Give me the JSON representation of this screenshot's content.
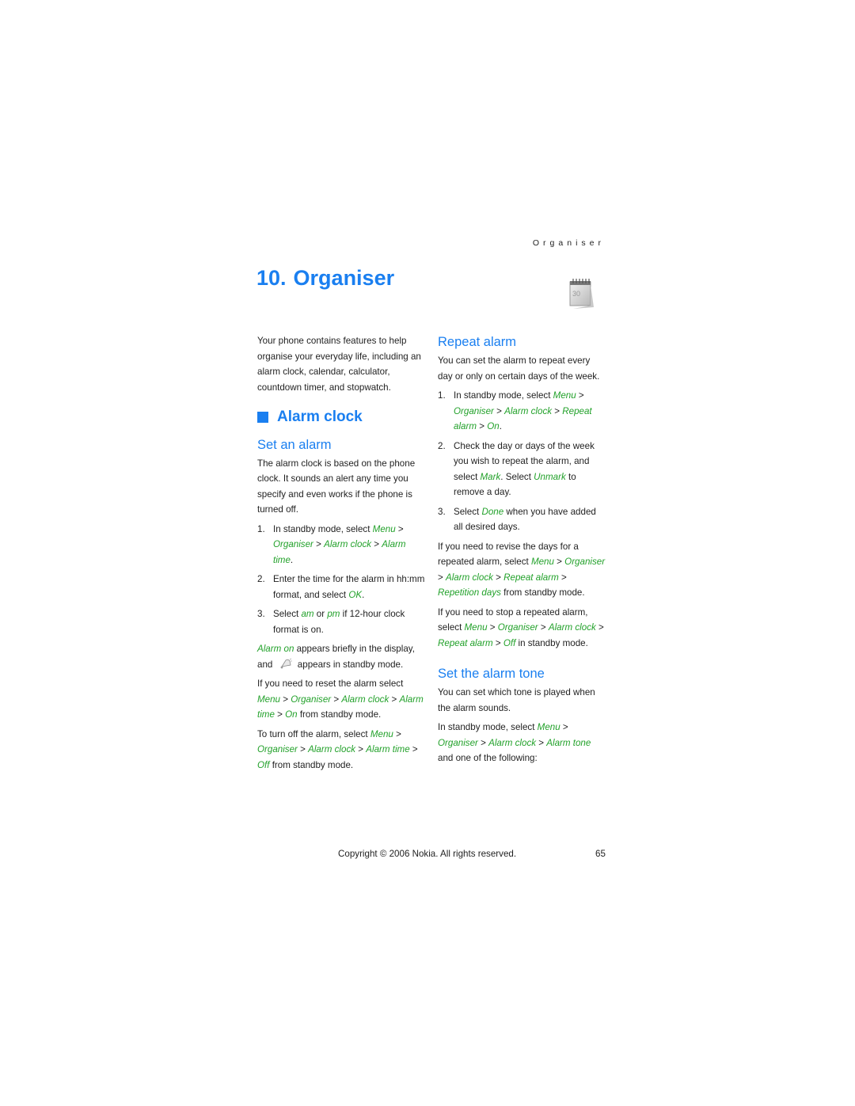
{
  "header": {
    "running_title": "Organiser"
  },
  "chapter": {
    "number": "10.",
    "title": "Organiser",
    "icon": "calendar-icon"
  },
  "intro": "Your phone contains features to help organise your everyday life, including an alarm clock, calendar, calculator, countdown timer, and stopwatch.",
  "alarm_clock": {
    "heading": "Alarm clock",
    "set_alarm": {
      "heading": "Set an alarm",
      "para": "The alarm clock is based on the phone clock. It sounds an alert any time you specify and even works if the phone is turned off.",
      "steps": [
        {
          "n": "1.",
          "t1": "In standby mode, select ",
          "m1": "Menu",
          "s1": " > ",
          "m2": "Organiser",
          "s2": " > ",
          "m3": "Alarm clock",
          "s3": " > ",
          "m4": "Alarm time",
          "t2": "."
        },
        {
          "n": "2.",
          "t1": "Enter the time for the alarm in hh:mm format, and select ",
          "m1": "OK",
          "t2": "."
        },
        {
          "n": "3.",
          "t1": "Select ",
          "m1": "am",
          "t2": " or ",
          "m2": "pm",
          "t3": " if 12-hour clock format is on."
        }
      ],
      "alarm_on": {
        "m1": "Alarm on",
        "t1": " appears briefly in the display, and ",
        "icon": "alarm-bell-icon",
        "t2": " appears in standby mode."
      },
      "reset": {
        "t1": "If you need to reset the alarm select ",
        "m1": "Menu",
        "s1": " > ",
        "m2": "Organiser",
        "s2": " > ",
        "m3": "Alarm clock",
        "s3": " > ",
        "m4": "Alarm time",
        "s4": " > ",
        "m5": "On",
        "t2": " from standby mode."
      },
      "turn_off": {
        "t1": "To turn off the alarm, select ",
        "m1": "Menu",
        "s1": " > ",
        "m2": "Organiser",
        "s2": " > ",
        "m3": "Alarm clock",
        "s3": " > ",
        "m4": "Alarm time",
        "s4": " > ",
        "m5": "Off",
        "t2": " from standby mode."
      }
    },
    "repeat_alarm": {
      "heading": "Repeat alarm",
      "para": "You can set the alarm to repeat every day or only on certain days of the week.",
      "steps": [
        {
          "n": "1.",
          "t1": "In standby mode, select ",
          "m1": "Menu",
          "s1": " > ",
          "m2": "Organiser",
          "s2": " > ",
          "m3": "Alarm clock",
          "s3": " > ",
          "m4": "Repeat alarm",
          "s4": " > ",
          "m5": "On",
          "t2": "."
        },
        {
          "n": "2.",
          "t1": "Check the day or days of the week you wish to repeat the alarm, and select ",
          "m1": "Mark",
          "t2": ". Select ",
          "m2": "Unmark",
          "t3": " to remove a day."
        },
        {
          "n": "3.",
          "t1": "Select ",
          "m1": "Done",
          "t2": " when you have added all desired days."
        }
      ],
      "revise": {
        "t1": "If you need to revise the days for a repeated alarm, select ",
        "m1": "Menu",
        "s1": " > ",
        "m2": "Organiser",
        "s2": " > ",
        "m3": "Alarm clock",
        "s3": " > ",
        "m4": "Repeat alarm",
        "s4": " > ",
        "m5": "Repetition days",
        "t2": " from standby mode."
      },
      "stop": {
        "t1": "If you need to stop a repeated alarm, select ",
        "m1": "Menu",
        "s1": " > ",
        "m2": "Organiser",
        "s2": " > ",
        "m3": "Alarm clock",
        "s3": " > ",
        "m4": "Repeat alarm",
        "s4": " > ",
        "m5": "Off",
        "t2": " in standby mode."
      }
    },
    "alarm_tone": {
      "heading": "Set the alarm tone",
      "para": "You can set which tone is played when the alarm sounds.",
      "instr": {
        "t1": "In standby mode, select ",
        "m1": "Menu",
        "s1": " > ",
        "m2": "Organiser",
        "s2": " > ",
        "m3": "Alarm clock",
        "s3": " > ",
        "m4": "Alarm tone",
        "t2": " and one of the following:"
      }
    }
  },
  "footer": {
    "copyright": "Copyright © 2006 Nokia. All rights reserved.",
    "page_number": "65"
  },
  "colors": {
    "heading_blue": "#1a7ff0",
    "menu_green": "#22a12a",
    "text": "#1f1f1f"
  }
}
